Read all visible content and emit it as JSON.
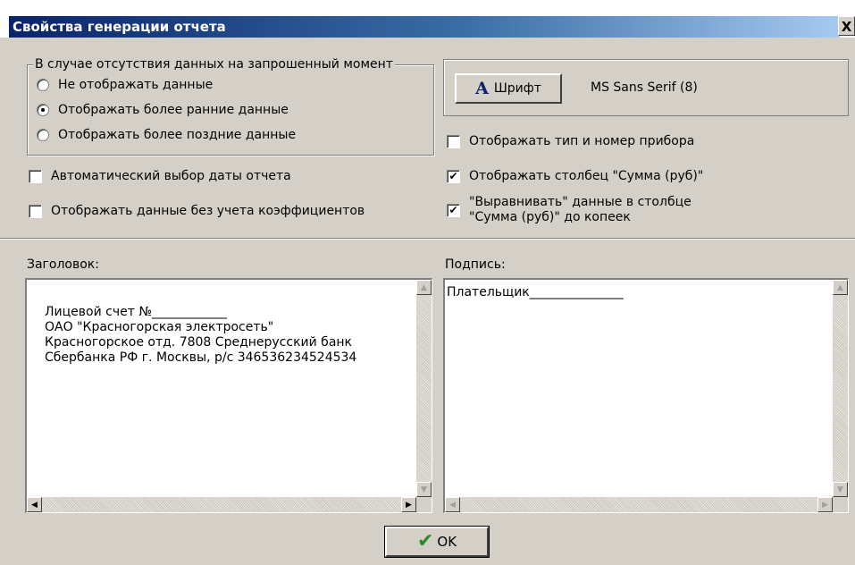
{
  "window": {
    "title": "Свойства генерации отчета",
    "close_glyph": "X"
  },
  "missing_data_group": {
    "legend": "В случае отсутствия данных на запрошенный момент",
    "options": [
      {
        "label": "Не отображать данные",
        "selected": false
      },
      {
        "label": "Отображать более ранние данные",
        "selected": true
      },
      {
        "label": "Отображать более поздние данные",
        "selected": false
      }
    ]
  },
  "font_panel": {
    "button_glyph": "A",
    "button_label": "Шрифт",
    "font_name": "MS Sans Serif (8)"
  },
  "checkboxes": {
    "auto_date": {
      "label": "Автоматический выбор даты отчета",
      "checked": false
    },
    "no_coefficients": {
      "label": "Отображать данные без учета коэффициентов",
      "checked": false
    },
    "show_device": {
      "label": "Отображать тип и номер прибора",
      "checked": false
    },
    "show_sum_column": {
      "label": "Отображать столбец \"Сумма (руб)\"",
      "checked": true
    },
    "align_sum": {
      "label_line1": "\"Выравнивать\" данные в столбце",
      "label_line2": "\"Сумма (руб)\" до копеек",
      "checked": true
    }
  },
  "header_memo": {
    "label": "Заголовок:",
    "text": "Лицевой счет №____________\nОАО \"Красногорская электросеть\"\nКрасногорское отд. 7808 Среднерусский банк\nСбербанка РФ г. Москвы, р/с 346536234524534"
  },
  "signature_memo": {
    "label": "Подпись:",
    "text": "Плательщик_______________"
  },
  "ok_button": {
    "label": "OK",
    "icon": "checkmark-icon"
  },
  "colors": {
    "title_start": "#0a246a",
    "title_end": "#a6caf0",
    "face": "#d4d0c8",
    "ok_check": "#2a8a2a"
  }
}
